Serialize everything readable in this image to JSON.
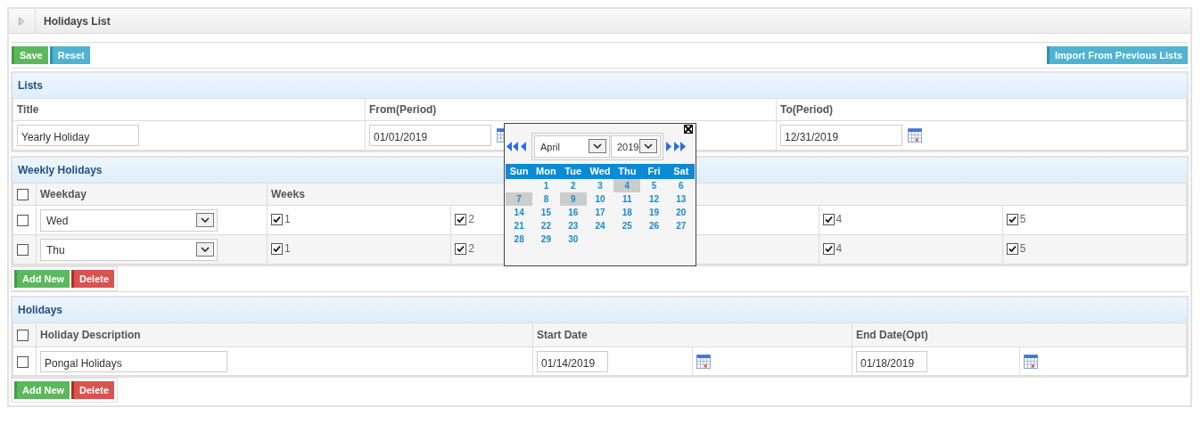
{
  "header": {
    "title": "Holidays List"
  },
  "toolbar": {
    "buttons": [
      {
        "label": "Save",
        "kind": "success"
      },
      {
        "label": "Reset",
        "kind": "info"
      }
    ],
    "right_button": {
      "label": "Import From Previous Lists",
      "kind": "info"
    }
  },
  "lists": {
    "heading": "Lists",
    "columns": [
      "Title",
      "From(Period)",
      "To(Period)"
    ],
    "title_value": "Yearly Holiday",
    "from_value": "01/01/2019",
    "to_value": "12/31/2019"
  },
  "weekly": {
    "heading": "Weekly Holidays",
    "all_checked": false,
    "columns": [
      "Weekday",
      "Weeks"
    ],
    "rows": [
      {
        "checked": false,
        "weekday": "Wed",
        "weeks": [
          {
            "kind": "week",
            "label": "1",
            "checked": true
          },
          {
            "kind": "week",
            "label": "2",
            "checked": true
          },
          {
            "kind": "hidden"
          },
          {
            "kind": "week",
            "label": "4",
            "checked": true
          },
          {
            "kind": "week",
            "label": "5",
            "checked": true
          }
        ]
      },
      {
        "checked": false,
        "weekday": "Thu",
        "weeks": [
          {
            "kind": "week",
            "label": "1",
            "checked": true
          },
          {
            "kind": "week",
            "label": "2",
            "checked": true
          },
          {
            "kind": "hidden"
          },
          {
            "kind": "week",
            "label": "4",
            "checked": true
          },
          {
            "kind": "week",
            "label": "5",
            "checked": true
          }
        ]
      }
    ],
    "buttons": [
      {
        "label": "Add New",
        "kind": "success"
      },
      {
        "label": "Delete",
        "kind": "danger"
      }
    ]
  },
  "holidays": {
    "heading": "Holidays",
    "all_checked": false,
    "columns": [
      "Holiday Description",
      "Start Date",
      "End Date(Opt)"
    ],
    "rows": [
      {
        "checked": false,
        "description": "Pongal Holidays",
        "start": "01/14/2019",
        "end": "01/18/2019"
      }
    ],
    "buttons": [
      {
        "label": "Add New",
        "kind": "success"
      },
      {
        "label": "Delete",
        "kind": "danger"
      }
    ]
  },
  "calendar": {
    "month": "April",
    "year": "2019",
    "weekdays": [
      "Sun",
      "Mon",
      "Tue",
      "Wed",
      "Thu",
      "Fri",
      "Sat"
    ],
    "weeks": [
      [
        {
          "kind": "blank"
        },
        {
          "kind": "day",
          "label": "1",
          "marked": false
        },
        {
          "kind": "day",
          "label": "2",
          "marked": false
        },
        {
          "kind": "day",
          "label": "3",
          "marked": false
        },
        {
          "kind": "day",
          "label": "4",
          "marked": true
        },
        {
          "kind": "day",
          "label": "5",
          "marked": false
        },
        {
          "kind": "day",
          "label": "6",
          "marked": false
        }
      ],
      [
        {
          "kind": "day",
          "label": "7",
          "marked": true
        },
        {
          "kind": "day",
          "label": "8",
          "marked": false
        },
        {
          "kind": "day",
          "label": "9",
          "marked": true
        },
        {
          "kind": "day",
          "label": "10",
          "marked": false
        },
        {
          "kind": "day",
          "label": "11",
          "marked": false
        },
        {
          "kind": "day",
          "label": "12",
          "marked": false
        },
        {
          "kind": "day",
          "label": "13",
          "marked": false
        }
      ],
      [
        {
          "kind": "day",
          "label": "14",
          "marked": false
        },
        {
          "kind": "day",
          "label": "15",
          "marked": false
        },
        {
          "kind": "day",
          "label": "16",
          "marked": false
        },
        {
          "kind": "day",
          "label": "17",
          "marked": false
        },
        {
          "kind": "day",
          "label": "18",
          "marked": false
        },
        {
          "kind": "day",
          "label": "19",
          "marked": false
        },
        {
          "kind": "day",
          "label": "20",
          "marked": false
        }
      ],
      [
        {
          "kind": "day",
          "label": "21",
          "marked": false
        },
        {
          "kind": "day",
          "label": "22",
          "marked": false
        },
        {
          "kind": "day",
          "label": "23",
          "marked": false
        },
        {
          "kind": "day",
          "label": "24",
          "marked": false
        },
        {
          "kind": "day",
          "label": "25",
          "marked": false
        },
        {
          "kind": "day",
          "label": "26",
          "marked": false
        },
        {
          "kind": "day",
          "label": "27",
          "marked": false
        }
      ],
      [
        {
          "kind": "day",
          "label": "28",
          "marked": false
        },
        {
          "kind": "day",
          "label": "29",
          "marked": false
        },
        {
          "kind": "day",
          "label": "30",
          "marked": false
        }
      ]
    ]
  }
}
